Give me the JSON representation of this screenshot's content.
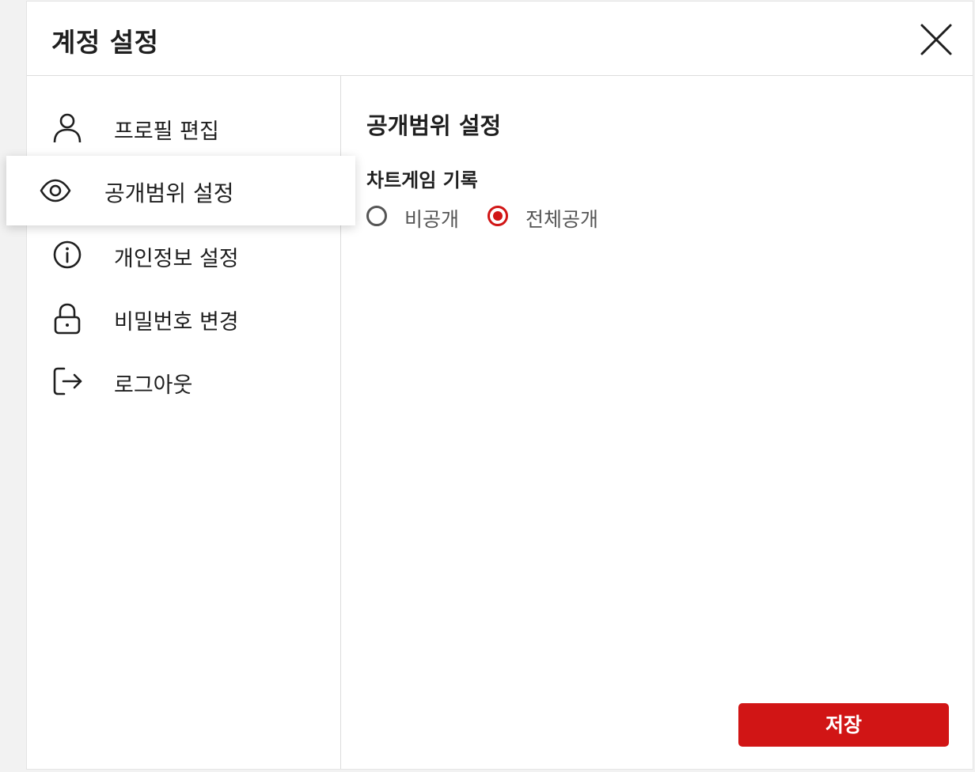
{
  "dialog": {
    "title": "계정 설정",
    "close_icon": "close-icon"
  },
  "sidebar": {
    "items": [
      {
        "label": "프로필 편집",
        "icon": "user-icon",
        "active": false
      },
      {
        "label": "공개범위 설정",
        "icon": "eye-icon",
        "active": true
      },
      {
        "label": "개인정보 설정",
        "icon": "info-icon",
        "active": false
      },
      {
        "label": "비밀번호 변경",
        "icon": "lock-icon",
        "active": false
      },
      {
        "label": "로그아웃",
        "icon": "logout-icon",
        "active": false
      }
    ]
  },
  "content": {
    "section_title": "공개범위 설정",
    "field_label": "차트게임 기록",
    "options": [
      {
        "label": "비공개",
        "checked": false
      },
      {
        "label": "전체공개",
        "checked": true
      }
    ],
    "save_label": "저장"
  },
  "colors": {
    "accent": "#d11515",
    "text": "#1f1f1f",
    "muted": "#555555",
    "divider": "#dcdcdc"
  }
}
